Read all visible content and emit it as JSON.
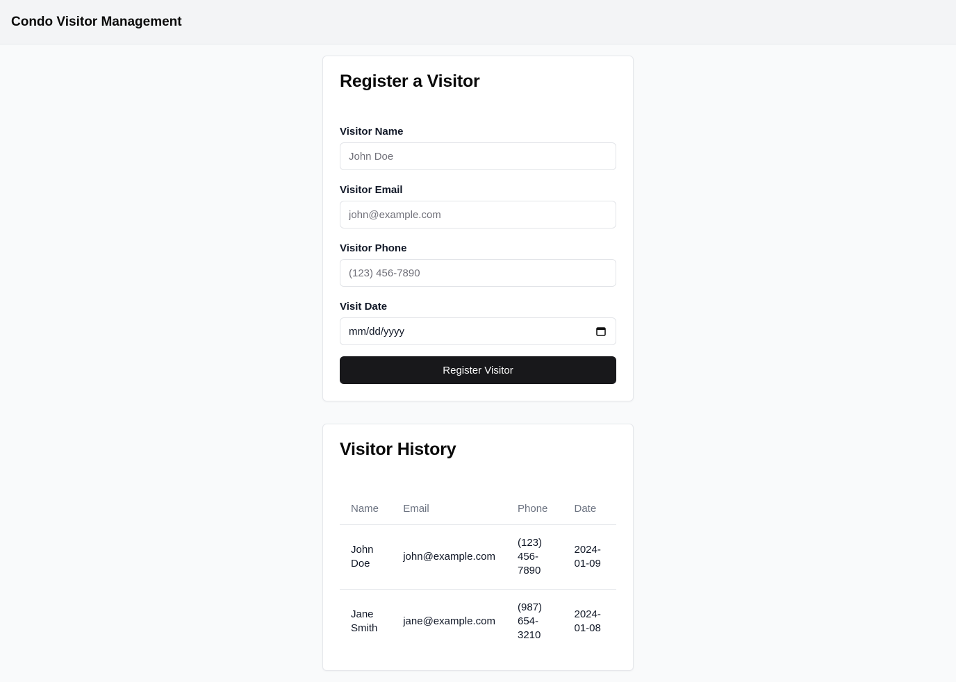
{
  "app": {
    "title": "Condo Visitor Management"
  },
  "register": {
    "title": "Register a Visitor",
    "fields": {
      "name": {
        "label": "Visitor Name",
        "placeholder": "John Doe",
        "value": ""
      },
      "email": {
        "label": "Visitor Email",
        "placeholder": "john@example.com",
        "value": ""
      },
      "phone": {
        "label": "Visitor Phone",
        "placeholder": "(123) 456-7890",
        "value": ""
      },
      "date": {
        "label": "Visit Date",
        "placeholder": "mm/dd/yyyy",
        "icon": "calendar-icon"
      }
    },
    "submit_label": "Register Visitor"
  },
  "history": {
    "title": "Visitor History",
    "columns": [
      "Name",
      "Email",
      "Phone",
      "Date"
    ],
    "rows": [
      {
        "name": "John Doe",
        "email": "john@example.com",
        "phone": "(123) 456-7890",
        "date": "2024-01-09"
      },
      {
        "name": "Jane Smith",
        "email": "jane@example.com",
        "phone": "(987) 654-3210",
        "date": "2024-01-08"
      }
    ]
  },
  "colors": {
    "page_bg": "#f9fafb",
    "header_bg": "#f3f4f6",
    "button_bg": "#18181b",
    "muted_text": "#6b7280"
  }
}
